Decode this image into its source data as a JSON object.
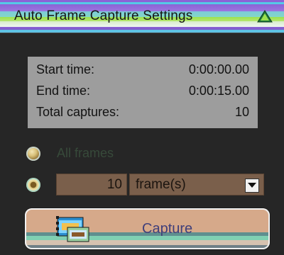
{
  "window": {
    "title": "Auto Frame Capture Settings",
    "collapse_icon": "collapse-up-icon"
  },
  "summary": {
    "start_label": "Start time:",
    "start_value": "0:00:00.00",
    "end_label": "End time:",
    "end_value": "0:00:15.00",
    "total_label": "Total captures:",
    "total_value": "10"
  },
  "mode": {
    "all_frames_label": "All frames",
    "all_frames_selected": false,
    "frames_selected": true
  },
  "frames": {
    "count_value": "10",
    "unit_selected": "frame(s)"
  },
  "capture": {
    "label": "Capture",
    "icon": "film-capture-icon"
  },
  "colors": {
    "summary_bg": "#9d9d9d",
    "input_bg": "#7a5f4b",
    "panel_bg": "#262626",
    "capture_text": "#3f3f7a"
  }
}
